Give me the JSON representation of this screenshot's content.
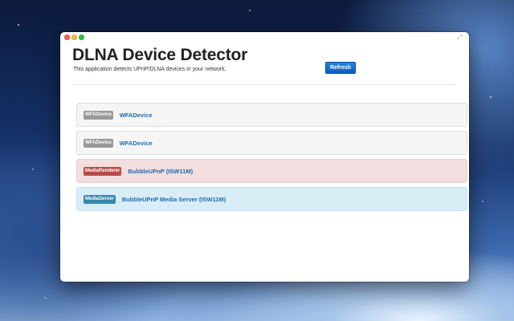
{
  "window": {
    "controls": [
      "close",
      "minimize",
      "zoom"
    ],
    "fullscreen_icon": "fullscreen-icon"
  },
  "header": {
    "title": "DLNA Device Detector",
    "subtitle": "This application detects UPnP/DLNA devices in your network.",
    "refresh_label": "Refresh"
  },
  "devices": [
    {
      "type": "WFADevice",
      "name": "WFADevice"
    },
    {
      "type": "WFADevice",
      "name": "WFADevice"
    },
    {
      "type": "MediaRenderer",
      "name": "BubbleUPnP (ISW11M)"
    },
    {
      "type": "MediaServer",
      "name": "BubbleUPnP Media Server (ISW11M)"
    }
  ],
  "colors": {
    "primary_button": "#1f86e0",
    "badge_default": "#999999",
    "badge_renderer": "#b94a48",
    "badge_server": "#3a87ad",
    "row_renderer_bg": "#f2dede",
    "row_server_bg": "#d9edf7",
    "link_text": "#1d69b5"
  }
}
